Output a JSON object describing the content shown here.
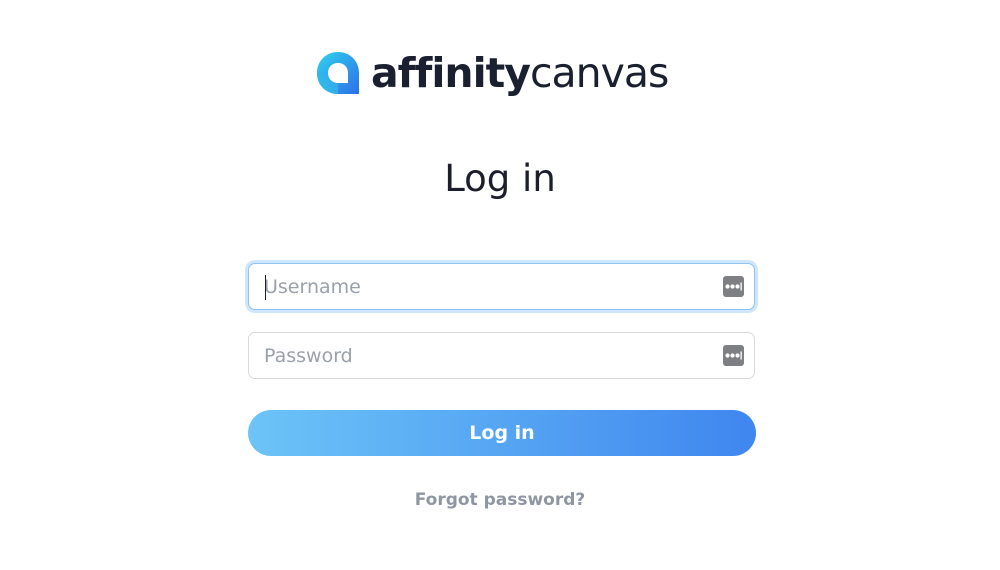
{
  "brand": {
    "name_bold": "affinity",
    "name_light": "canvas",
    "icon": "affinity-logo-icon",
    "gradient_colors": [
      "#25c7e8",
      "#2e6fe8"
    ]
  },
  "page": {
    "title": "Log in"
  },
  "form": {
    "username": {
      "value": "",
      "placeholder": "Username",
      "icon": "password-manager-icon",
      "focused": true
    },
    "password": {
      "value": "",
      "placeholder": "Password",
      "icon": "password-manager-icon"
    },
    "submit_label": "Log in",
    "forgot_label": "Forgot password?"
  },
  "colors": {
    "button_gradient": [
      "#6cc4f7",
      "#3f86ef"
    ],
    "focus_ring": "#cfe5fb",
    "link": "#8f96a3"
  }
}
